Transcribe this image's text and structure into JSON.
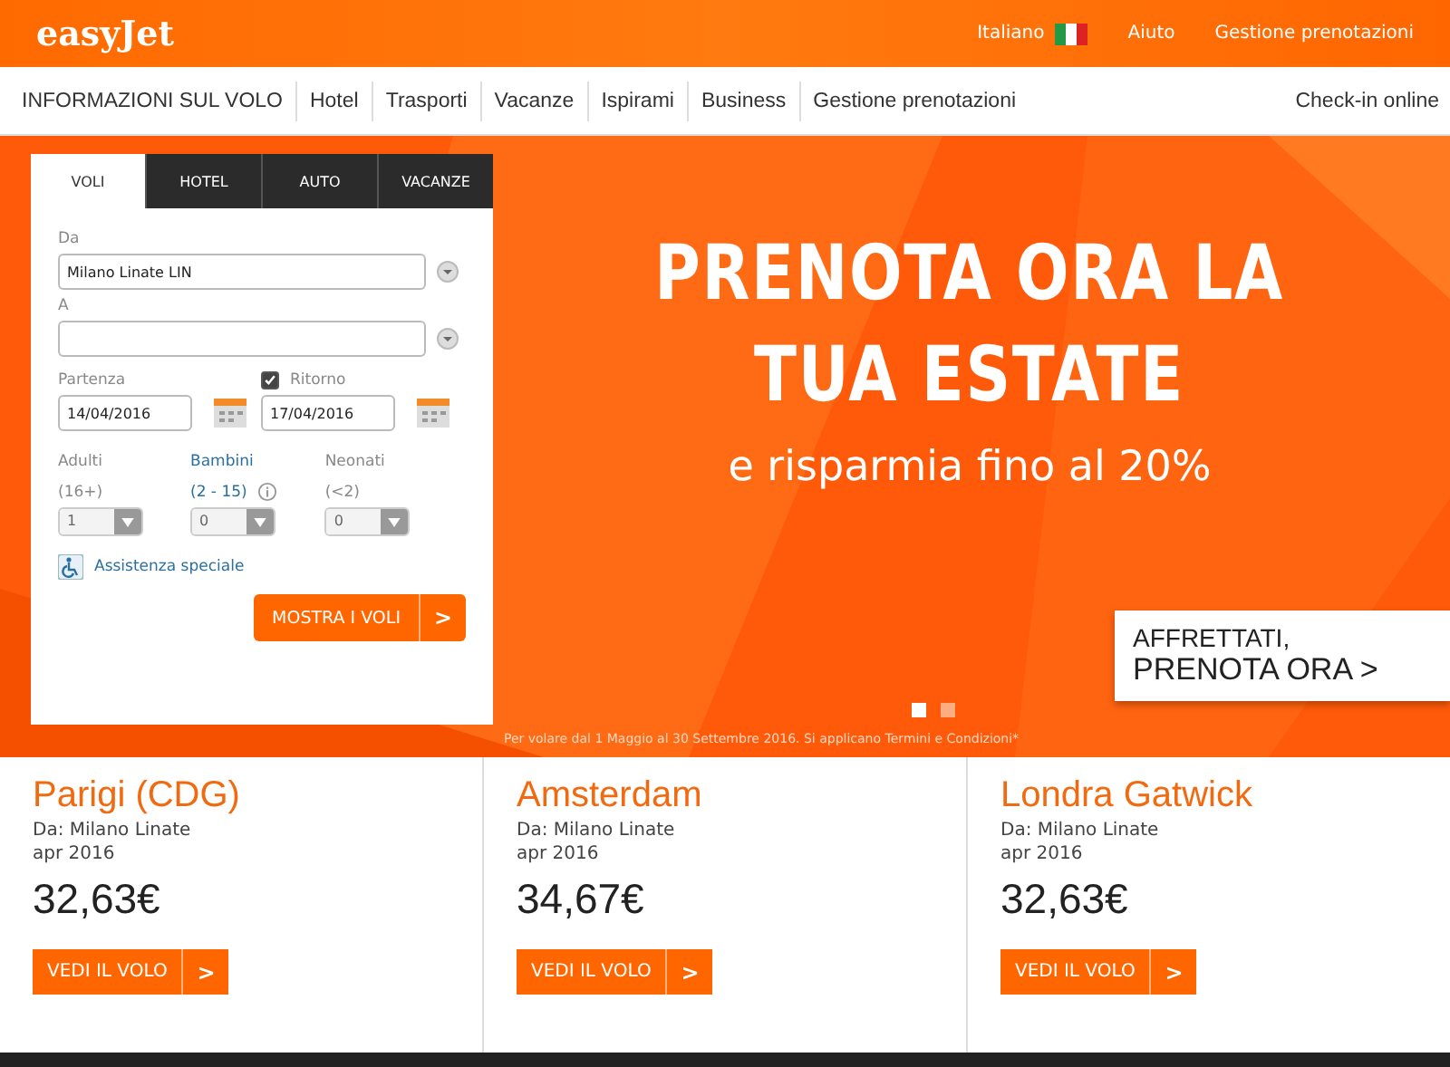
{
  "header": {
    "logo": "easyJet",
    "links": [
      {
        "label": "Italiano",
        "kind": "language"
      },
      {
        "label": "Aiuto",
        "kind": "link"
      },
      {
        "label": "Gestione prenotazioni",
        "kind": "link"
      }
    ]
  },
  "nav": {
    "items": [
      "INFORMAZIONI SUL VOLO",
      "Hotel",
      "Trasporti",
      "Vacanze",
      "Ispirami",
      "Business",
      "Gestione prenotazioni"
    ],
    "checkin": "Check-in online"
  },
  "booking": {
    "tabs": [
      {
        "label": "VOLI",
        "selected": true
      },
      {
        "label": "HOTEL",
        "selected": false
      },
      {
        "label": "AUTO",
        "selected": false
      },
      {
        "label": "VACANZE",
        "selected": false
      }
    ],
    "from": {
      "label": "Da",
      "value": "Milano Linate LIN"
    },
    "to": {
      "label": "A"
    },
    "departure": {
      "label": "Partenza",
      "value": "14/04/2016"
    },
    "return": {
      "label": "Ritorno",
      "value": "17/04/2016",
      "checked": true
    },
    "passengers": [
      {
        "label": "Adulti",
        "range": "(16+)",
        "value": "1",
        "info": false
      },
      {
        "label": "Bambini",
        "range": "(2 - 15)",
        "value": "0",
        "info": true
      },
      {
        "label": "Neonati",
        "range": "(<2)",
        "value": "0",
        "info": false
      }
    ],
    "assistance": "Assistenza speciale",
    "submit": "MOSTRA I VOLI",
    "submit_arrow": ">"
  },
  "hero": {
    "headline": [
      "PRENOTA ORA LA",
      "TUA ESTATE"
    ],
    "subline": "e risparmia fino al 20%",
    "cta": [
      "AFFRETTATI,",
      "PRENOTA ORA >"
    ],
    "slides": [
      {
        "selected": true
      },
      {
        "selected": false
      }
    ],
    "disclaimer": "Per volare dal 1 Maggio al 30 Settembre 2016. Si applicano Termini e Condizioni*"
  },
  "deals": [
    {
      "city": "Parigi (CDG)",
      "origin": "Da: Milano Linate",
      "date": "apr 2016",
      "price": "32,63€",
      "button": "VEDI IL VOLO",
      "arrow": ">"
    },
    {
      "city": "Amsterdam",
      "origin": "Da: Milano Linate",
      "date": "apr 2016",
      "price": "34,67€",
      "button": "VEDI IL VOLO",
      "arrow": ">"
    },
    {
      "city": "Londra Gatwick",
      "origin": "Da: Milano Linate",
      "date": "apr 2016",
      "price": "32,63€",
      "button": "VEDI IL VOLO",
      "arrow": ">"
    }
  ]
}
